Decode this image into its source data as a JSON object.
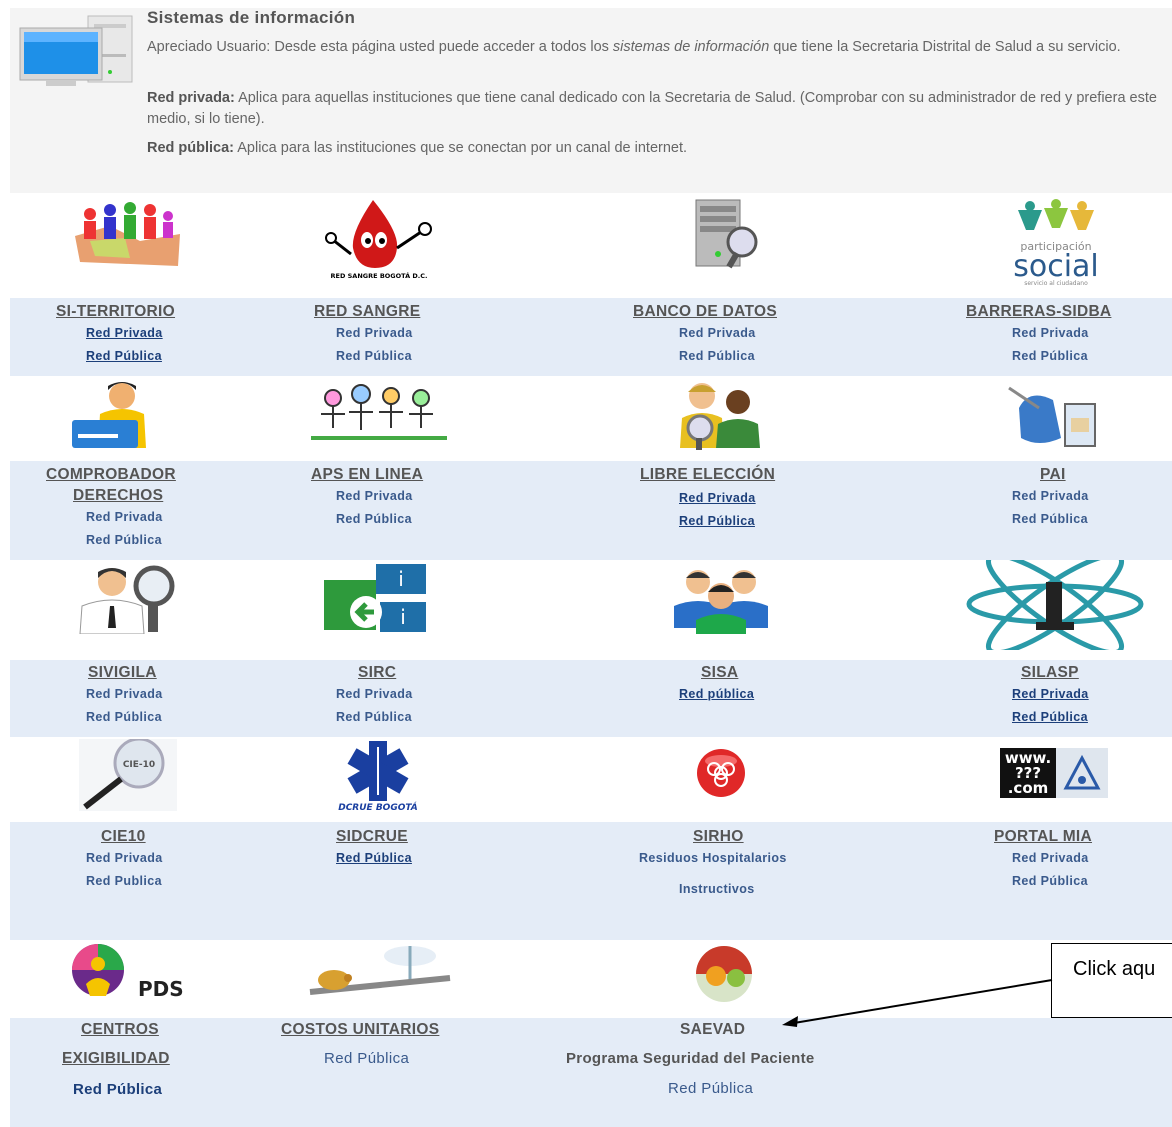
{
  "header": {
    "title": "Sistemas de información",
    "intro_prefix": "Apreciado Usuario: Desde esta página usted puede acceder a todos los ",
    "intro_em": "sistemas de información",
    "intro_suffix": " que tiene la Secretaria Distrital de Salud a su servicio.",
    "private_label": "Red privada:",
    "private_text": " Aplica para aquellas instituciones que tiene canal dedicado con la Secretaria de Salud. (Comprobar con su administrador de red y prefiera este medio, si lo tiene).",
    "public_label": "Red pública:",
    "public_text": " Aplica para las instituciones que se conectan por un canal de internet."
  },
  "systems": {
    "si_territorio": {
      "title": "SI-TERRITORIO",
      "l1": "Red Privada",
      "l2": "Red Pública"
    },
    "red_sangre": {
      "title": "RED SANGRE",
      "l1": "Red Privada",
      "l2": "Red Pública",
      "img_caption": "RED SANGRE BOGOTÁ D.C."
    },
    "banco_datos": {
      "title": "BANCO DE DATOS",
      "l1": "Red Privada",
      "l2": "Red Pública"
    },
    "barreras": {
      "title": "BARRERAS-SIDBA",
      "l1": "Red Privada",
      "l2": "Red Pública",
      "img_top": "participación",
      "img_main": "social",
      "img_sub": "servicio al ciudadano"
    },
    "comprobador": {
      "title1": "COMPROBADOR",
      "title2": "DERECHOS",
      "l1": "Red Privada",
      "l2": "Red Pública"
    },
    "aps": {
      "title": "APS EN LINEA",
      "l1": "Red Privada",
      "l2": "Red Pública"
    },
    "libre": {
      "title": "LIBRE ELECCIÓN",
      "l1": "Red Privada",
      "l2": "Red Pública"
    },
    "pai": {
      "title": "PAI",
      "l1": "Red Privada",
      "l2": "Red Pública"
    },
    "sivigila": {
      "title": "SIVIGILA",
      "l1": "Red Privada",
      "l2": "Red Pública"
    },
    "sirc": {
      "title": "SIRC",
      "l1": "Red Privada",
      "l2": "Red Pública"
    },
    "sisa": {
      "title": "SISA",
      "l1": "Red pública"
    },
    "silasp": {
      "title": "SILASP",
      "l1": "Red Privada",
      "l2": "Red Pública"
    },
    "cie10": {
      "title": "CIE10",
      "l1": "Red Privada",
      "l2": "Red Publica",
      "img_label": "CIE-10"
    },
    "sidcrue": {
      "title": "SIDCRUE",
      "l1": "Red Pública",
      "img_caption": "DCRUE BOGOTÁ"
    },
    "sirho": {
      "title": "SIRHO",
      "l1": "Residuos Hospitalarios",
      "l2": "Instructivos"
    },
    "portal_mia": {
      "title": "PORTAL MIA",
      "l1": "Red Privada",
      "l2": "Red Pública",
      "img_l1": "www.",
      "img_l2": "???",
      "img_l3": ".com"
    },
    "centros": {
      "title1": "CENTROS",
      "title2": "EXIGIBILIDAD",
      "l1": "Red Pública",
      "img_label": "PDS"
    },
    "costos": {
      "title": "COSTOS UNITARIOS",
      "l1": "Red Pública"
    },
    "saevad": {
      "title": "SAEVAD",
      "l1": "Programa Seguridad del Paciente",
      "l2": "Red Pública"
    }
  },
  "callout": {
    "text": "Click aqu"
  },
  "colors": {
    "band": "#e4ecf7",
    "link": "#1c3f7a",
    "title": "#555555"
  }
}
